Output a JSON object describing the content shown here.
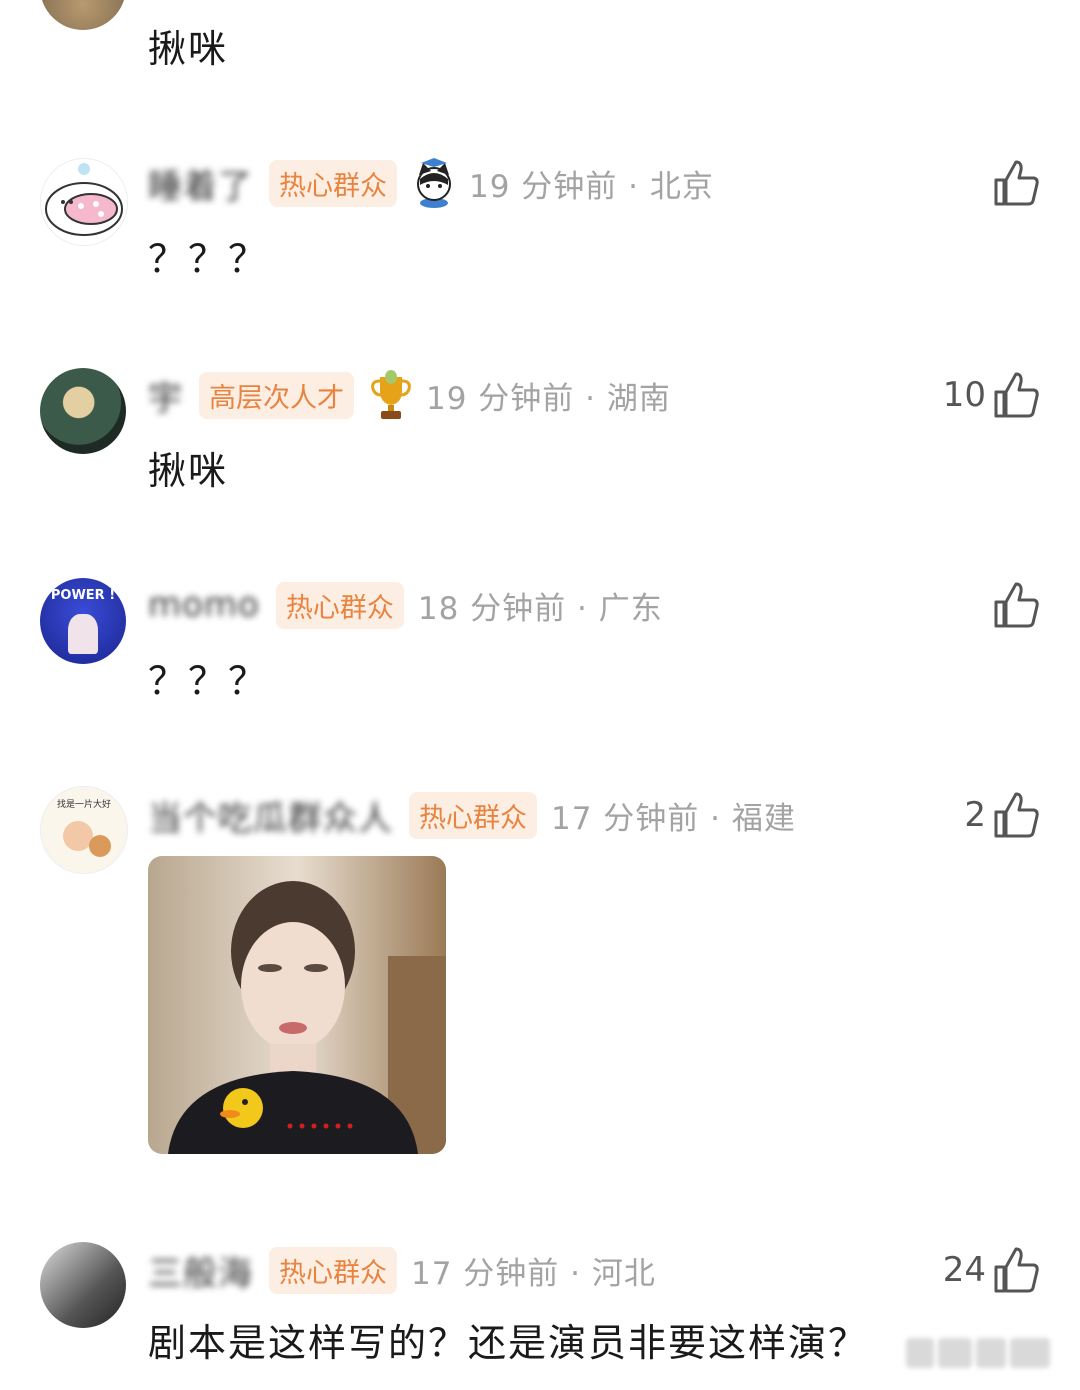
{
  "top_partial": {
    "content": "揪咪"
  },
  "comments": [
    {
      "username": "睡着了",
      "badge": "热心群众",
      "time": "19 分钟前 · 北京",
      "likes": "",
      "content": "？？？"
    },
    {
      "username": "宇",
      "badge": "高层次人才",
      "time": "19 分钟前 · 湖南",
      "likes": "10",
      "content": "揪咪"
    },
    {
      "username": "momo",
      "badge": "热心群众",
      "time": "18 分钟前 · 广东",
      "likes": "",
      "content": "？？？"
    },
    {
      "username": "当个吃瓜群众人",
      "badge": "热心群众",
      "time": "17 分钟前 · 福建",
      "likes": "2",
      "content": ""
    },
    {
      "username": "三般海",
      "badge": "热心群众",
      "time": "17 分钟前 · 河北",
      "likes": "24",
      "content": "剧本是这样写的？还是演员非要这样演？"
    }
  ],
  "avatar_texts": {
    "power": "POWER !",
    "cap": "找是一片大好"
  },
  "colors": {
    "badge_bg": "#fdeee3",
    "badge_text": "#e8843f",
    "meta_text": "#a3a3a3"
  },
  "icons": [
    "like-icon",
    "cat-icon",
    "trophy-icon",
    "duck-emoji-icon"
  ]
}
